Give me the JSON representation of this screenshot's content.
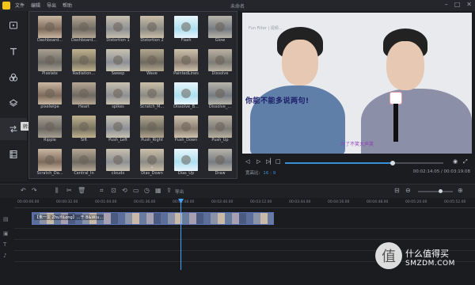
{
  "window": {
    "menu": [
      "文件",
      "编辑",
      "导出",
      "帮助"
    ],
    "title": "未命名",
    "controls": [
      "–",
      "□",
      "✕"
    ]
  },
  "sidebar": {
    "tooltip": "转场",
    "items": [
      "media",
      "text",
      "filter",
      "overlay",
      "transition",
      "element"
    ]
  },
  "effects": {
    "tiles": [
      {
        "label": "Dashboard..."
      },
      {
        "label": "Dashboard..."
      },
      {
        "label": "Distortion 1"
      },
      {
        "label": "Distortion 2"
      },
      {
        "label": "Flash"
      },
      {
        "label": "Glow"
      },
      {
        "label": "Pixelate"
      },
      {
        "label": "Radiation..."
      },
      {
        "label": "Sweep"
      },
      {
        "label": "Wave"
      },
      {
        "label": "PaintedLines"
      },
      {
        "label": "Dissolve"
      },
      {
        "label": "pixelwipe"
      },
      {
        "label": "Heart"
      },
      {
        "label": "spikes"
      },
      {
        "label": "Scratch_M..."
      },
      {
        "label": "Dissolve_B..."
      },
      {
        "label": "Dissolve_..."
      },
      {
        "label": "Ripple"
      },
      {
        "label": "Sift"
      },
      {
        "label": "Push_Left"
      },
      {
        "label": "Push_Right"
      },
      {
        "label": "Push_Down"
      },
      {
        "label": "Push_Up"
      },
      {
        "label": "Scratch_Da..."
      },
      {
        "label": "Central_In"
      },
      {
        "label": "clouds"
      },
      {
        "label": "Dias_Down"
      },
      {
        "label": "Dias_Up"
      },
      {
        "label": "Draw"
      }
    ]
  },
  "preview": {
    "watermark": "Fun Filter | 视频...",
    "subtitle_main": "你能不能多说两句!",
    "subtitle_sub": "为了不笑大声笑"
  },
  "player": {
    "ratio_label": "宽高比:",
    "ratio_value": "16 : 9",
    "time": "00:02:14.05 / 00:03:19.08",
    "progress": 0.68
  },
  "toolbar": {
    "export_label": "导出",
    "zoom_level": 0.6
  },
  "timeline": {
    "ticks": [
      "00:00:00.00",
      "00:00:32.00",
      "00:01:04.00",
      "00:01:36.00",
      "00:02:08.00",
      "00:02:40.00",
      "00:03:12.00",
      "00:03:44.00",
      "00:04:16.00",
      "00:04:48.00",
      "00:05:20.00",
      "00:05:52.00"
    ],
    "clip_name": "【朱一龙 ZhuYiLong】...于 B&W(u..."
  },
  "watermark_site": {
    "name": "什么值得买",
    "domain": "SMZDM.COM"
  },
  "colors": {
    "accent": "#3b8fd9",
    "logo": "#f5c518",
    "subtitle_main": "#1c1d6a",
    "subtitle_sub": "#8e3fb8"
  }
}
